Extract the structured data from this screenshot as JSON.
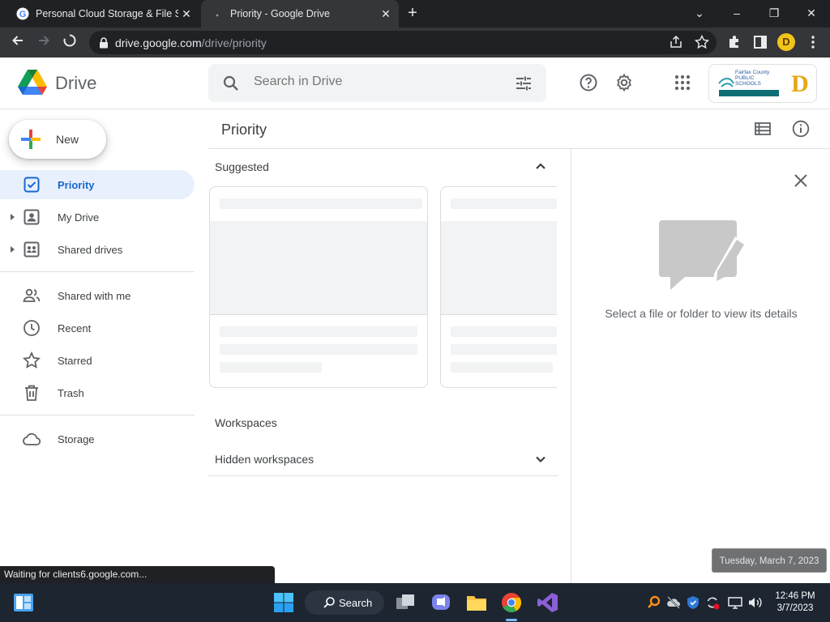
{
  "browser": {
    "tabs": [
      {
        "title": "Personal Cloud Storage & File Sh",
        "active": false
      },
      {
        "title": "Priority - Google Drive",
        "active": true
      }
    ],
    "url_host": "drive.google.com",
    "url_path": "/drive/priority",
    "profile_initial": "D",
    "status_text": "Waiting for clients6.google.com..."
  },
  "header": {
    "app_name": "Drive",
    "search_placeholder": "Search in Drive",
    "org_name": "Fairfax County PUBLIC SCHOOLS",
    "account_initial": "D"
  },
  "sidebar": {
    "new_label": "New",
    "items": [
      {
        "label": "Priority",
        "icon": "priority-check-icon",
        "active": true
      },
      {
        "label": "My Drive",
        "icon": "my-drive-icon"
      },
      {
        "label": "Shared drives",
        "icon": "shared-drives-icon"
      },
      {
        "label": "Shared with me",
        "icon": "people-icon"
      },
      {
        "label": "Recent",
        "icon": "clock-icon"
      },
      {
        "label": "Starred",
        "icon": "star-icon"
      },
      {
        "label": "Trash",
        "icon": "trash-icon"
      },
      {
        "label": "Storage",
        "icon": "cloud-icon"
      }
    ]
  },
  "main": {
    "title": "Priority",
    "suggested_label": "Suggested",
    "workspaces_label": "Workspaces",
    "hidden_workspaces_label": "Hidden workspaces"
  },
  "details": {
    "empty_text": "Select a file or folder to view its details"
  },
  "tooltip": {
    "text": "Tuesday, March 7, 2023"
  },
  "taskbar": {
    "search_label": "Search",
    "time": "12:46 PM",
    "date": "3/7/2023"
  },
  "colors": {
    "accent": "#1967d2",
    "active_nav_bg": "#e8f0fe",
    "taskbar_bg": "#1c2530"
  }
}
